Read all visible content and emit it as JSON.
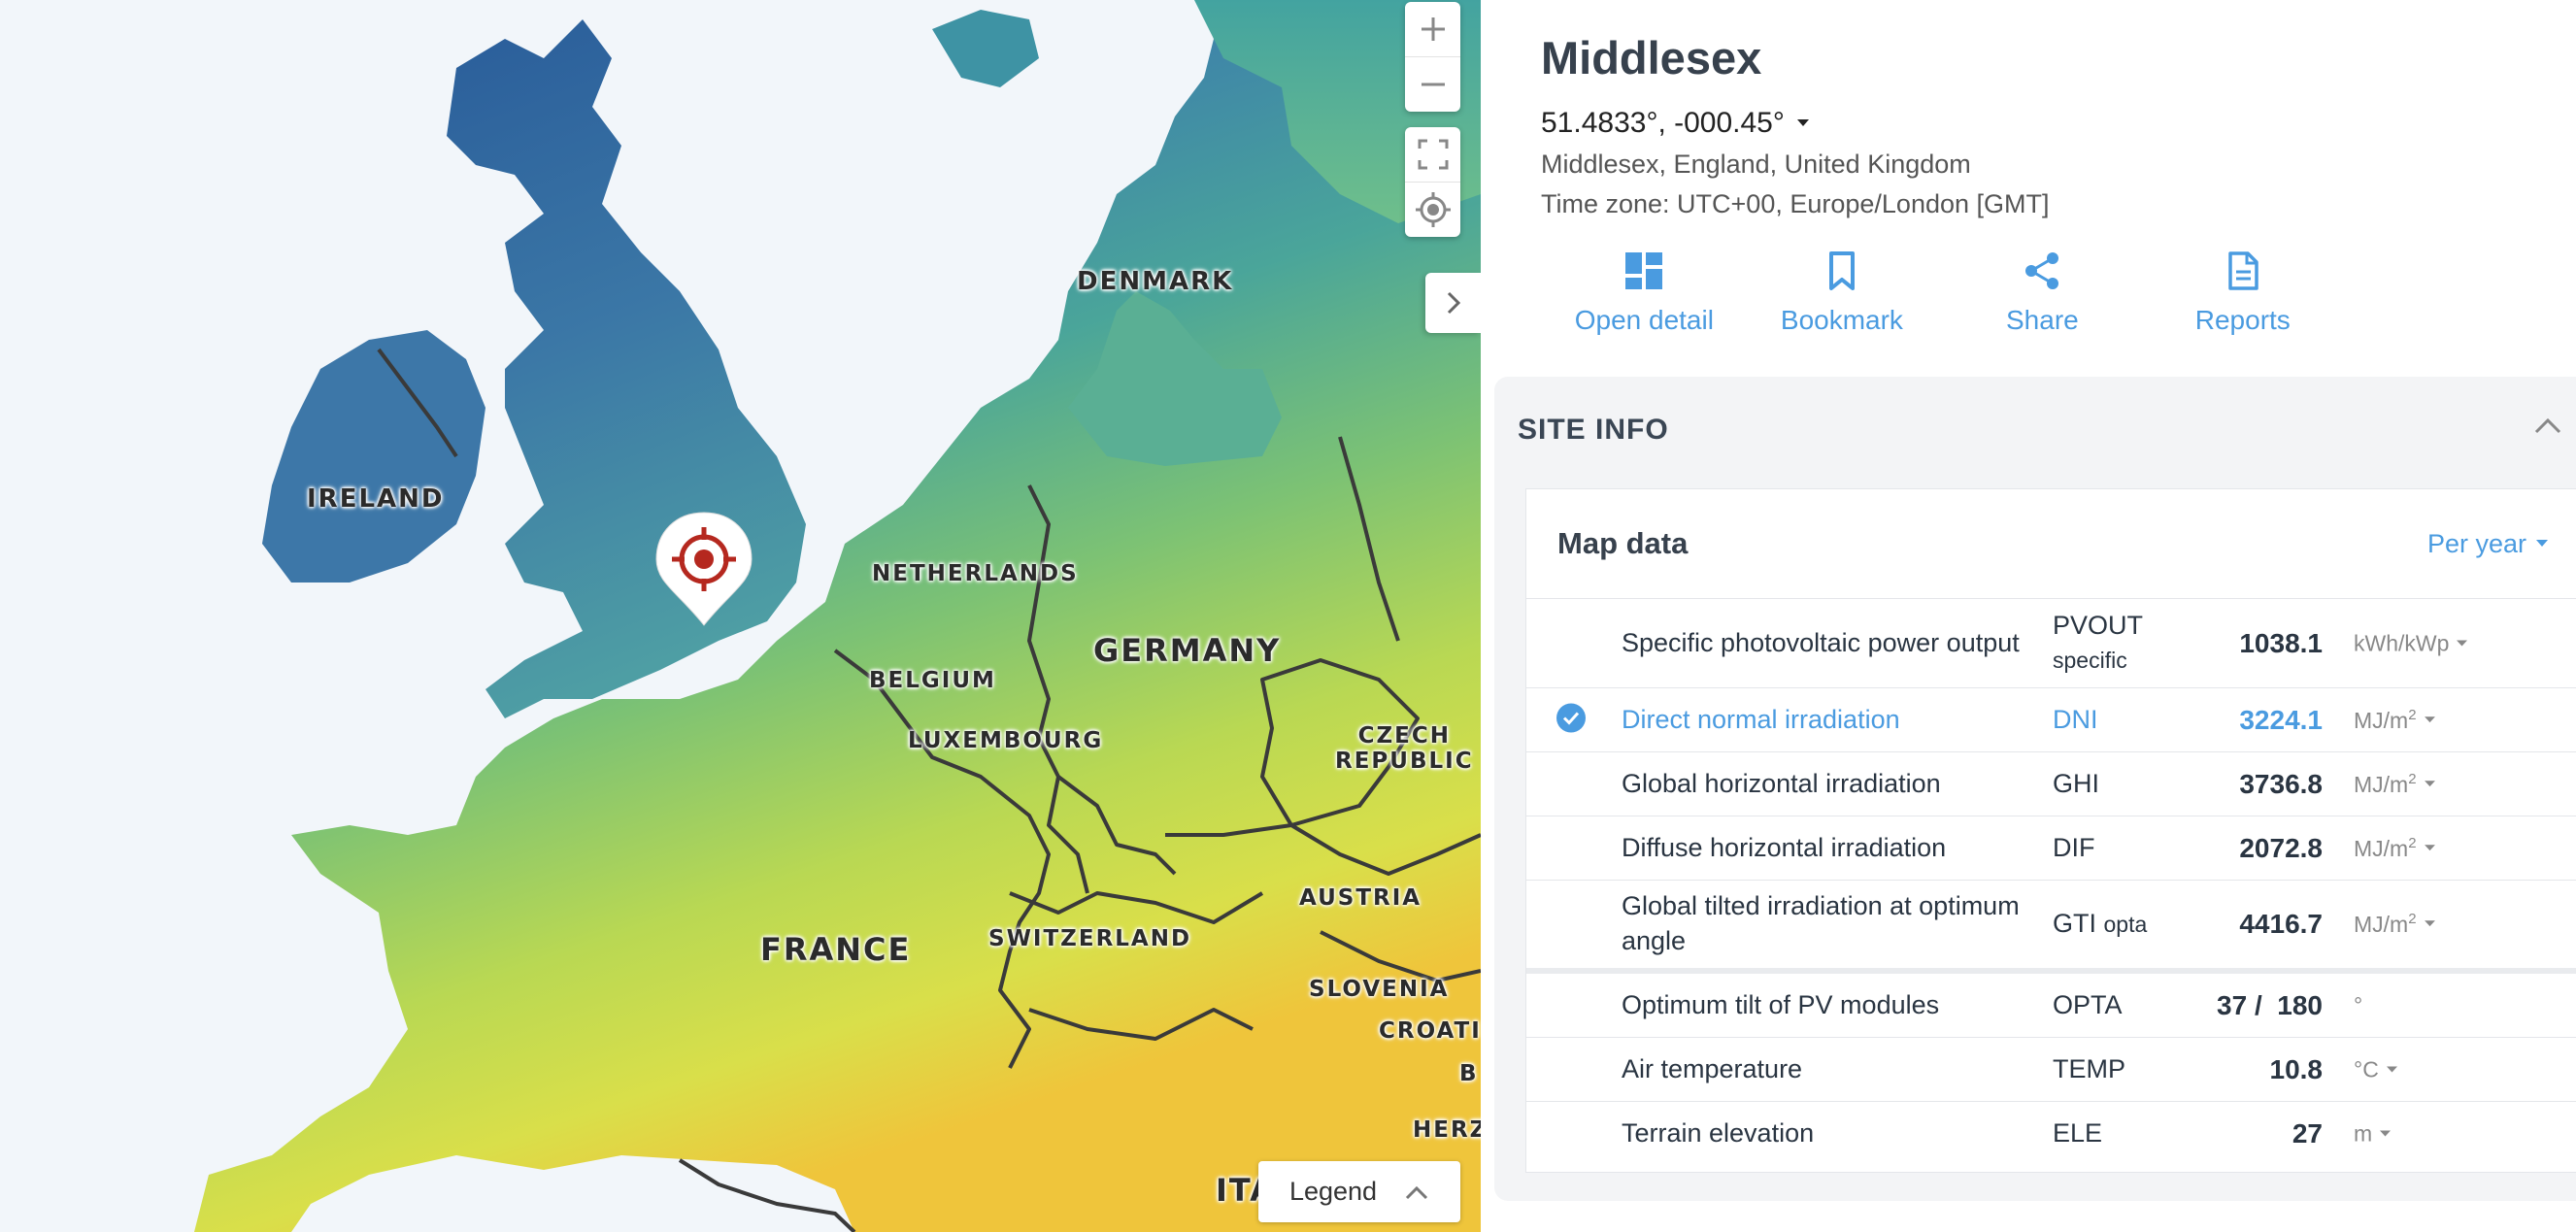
{
  "map": {
    "labels": {
      "denmark": "DENMARK",
      "ireland": "IRELAND",
      "netherlands": "NETHERLANDS",
      "germany": "GERMANY",
      "belgium": "BELGIUM",
      "luxembourg": "LUXEMBOURG",
      "czech_1": "CZECH",
      "czech_2": "REPUBLIC",
      "france": "FRANCE",
      "switzerland": "SWITZERLAND",
      "austria": "AUSTRIA",
      "slovenia": "SLOVENIA",
      "croatia": "CROATI",
      "italy": "ITA",
      "herz": "HERZ",
      "b": "B"
    },
    "legend_label": "Legend",
    "marker_icon": "target-pin-icon",
    "colors": {
      "marker": "#b5281f",
      "accent": "#4a9be0"
    }
  },
  "site": {
    "title": "Middlesex",
    "coordinates": "51.4833°, -000.45°",
    "address": "Middlesex, England, United Kingdom",
    "timezone": "Time zone: UTC+00, Europe/London [GMT]"
  },
  "actions": [
    {
      "label": "Open detail",
      "icon": "dashboard-icon"
    },
    {
      "label": "Bookmark",
      "icon": "bookmark-icon"
    },
    {
      "label": "Share",
      "icon": "share-icon"
    },
    {
      "label": "Reports",
      "icon": "document-icon"
    }
  ],
  "site_info": {
    "heading": "SITE INFO",
    "map_data": {
      "title": "Map data",
      "period": "Per year",
      "rows": [
        {
          "name": "Specific photovoltaic power output",
          "abbr": "PVOUT",
          "abbr_sub": "specific",
          "value": "1038.1",
          "unit": "kWh/kWp",
          "unit_sup": ""
        },
        {
          "name": "Direct normal irradiation",
          "abbr": "DNI",
          "abbr_sub": "",
          "value": "3224.1",
          "unit": "MJ/m",
          "unit_sup": "2"
        },
        {
          "name": "Global horizontal irradiation",
          "abbr": "GHI",
          "abbr_sub": "",
          "value": "3736.8",
          "unit": "MJ/m",
          "unit_sup": "2"
        },
        {
          "name": "Diffuse horizontal irradiation",
          "abbr": "DIF",
          "abbr_sub": "",
          "value": "2072.8",
          "unit": "MJ/m",
          "unit_sup": "2"
        },
        {
          "name": "Global tilted irradiation at optimum angle",
          "abbr": "GTI",
          "abbr_sub": "opta",
          "value": "4416.7",
          "unit": "MJ/m",
          "unit_sup": "2"
        },
        {
          "name": "Optimum tilt of PV modules",
          "abbr": "OPTA",
          "abbr_sub": "",
          "value": "37 /  180",
          "unit": "°",
          "unit_sup": ""
        },
        {
          "name": "Air temperature",
          "abbr": "TEMP",
          "abbr_sub": "",
          "value": "10.8",
          "unit": "°C",
          "unit_sup": ""
        },
        {
          "name": "Terrain elevation",
          "abbr": "ELE",
          "abbr_sub": "",
          "value": "27",
          "unit": "m",
          "unit_sup": ""
        }
      ],
      "selected_row": "Direct normal irradiation"
    }
  }
}
